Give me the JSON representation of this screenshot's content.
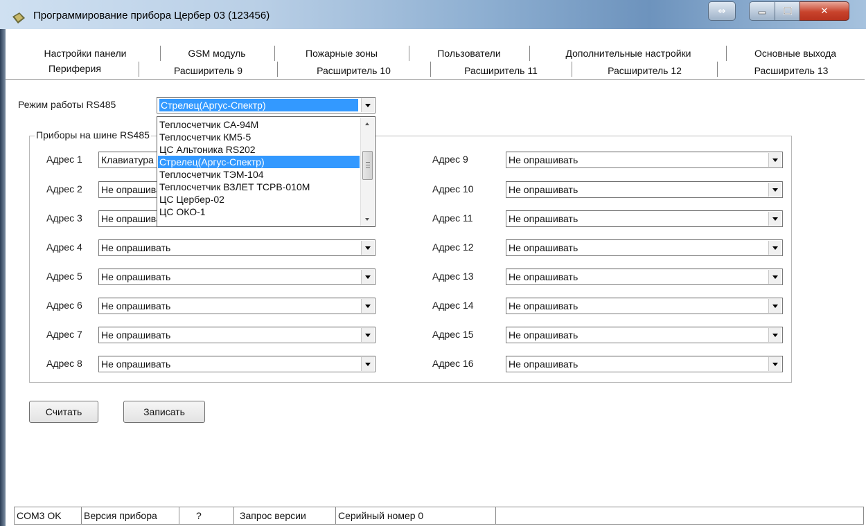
{
  "window": {
    "title": "Программирование прибора Цербер 03 (123456)"
  },
  "tabs": {
    "row1": [
      "Настройки панели",
      "GSM модуль",
      "Пожарные зоны",
      "Пользователи",
      "Дополнительные настройки",
      "Основные выхода"
    ],
    "row2": [
      "Периферия",
      "Расширитель 9",
      "Расширитель 10",
      "Расширитель 11",
      "Расширитель 12",
      "Расширитель 13"
    ],
    "active": "Периферия"
  },
  "rs485": {
    "label": "Режим работы RS485",
    "value": "Стрелец(Аргус-Спектр)"
  },
  "dropdown": {
    "items": [
      "Теплосчетчик СА-94М",
      "Теплосчетчик КМ5-5",
      "ЦС Альтоника RS202",
      "Стрелец(Аргус-Спектр)",
      "Теплосчетчик ТЭМ-104",
      "Теплосчетчик ВЗЛЕТ ТСРВ-010М",
      "ЦС Цербер-02",
      "ЦС ОКО-1"
    ],
    "selected": "Стрелец(Аргус-Спектр)"
  },
  "group": {
    "title": "Приборы на шине RS485"
  },
  "addresses_left": [
    {
      "label": "Адрес 1",
      "value": "Клавиатура"
    },
    {
      "label": "Адрес 2",
      "value": "Не опрашивать"
    },
    {
      "label": "Адрес 3",
      "value": "Не опрашивать"
    },
    {
      "label": "Адрес 4",
      "value": "Не опрашивать"
    },
    {
      "label": "Адрес 5",
      "value": "Не опрашивать"
    },
    {
      "label": "Адрес 6",
      "value": "Не опрашивать"
    },
    {
      "label": "Адрес 7",
      "value": "Не опрашивать"
    },
    {
      "label": "Адрес 8",
      "value": "Не опрашивать"
    }
  ],
  "addresses_right": [
    {
      "label": "Адрес 9",
      "value": "Не опрашивать"
    },
    {
      "label": "Адрес 10",
      "value": "Не опрашивать"
    },
    {
      "label": "Адрес 11",
      "value": "Не опрашивать"
    },
    {
      "label": "Адрес 12",
      "value": "Не опрашивать"
    },
    {
      "label": "Адрес 13",
      "value": "Не опрашивать"
    },
    {
      "label": "Адрес 14",
      "value": "Не опрашивать"
    },
    {
      "label": "Адрес 15",
      "value": "Не опрашивать"
    },
    {
      "label": "Адрес 16",
      "value": "Не опрашивать"
    }
  ],
  "buttons": {
    "read": "Считать",
    "write": "Записать"
  },
  "statusbar": {
    "port": "COM3 OK",
    "version": "Версия прибора",
    "question": "?",
    "version_request": "Запрос версии",
    "serial": "Серийный номер 0",
    "extra": ""
  },
  "colors": {
    "selection": "#3399ff",
    "close_button": "#c8432c"
  },
  "icons": {
    "app": "app-icon",
    "switch": "switch-window-icon",
    "minimize": "minimize-icon",
    "maximize": "maximize-icon",
    "close": "close-icon",
    "dropdown": "chevron-down-icon"
  }
}
